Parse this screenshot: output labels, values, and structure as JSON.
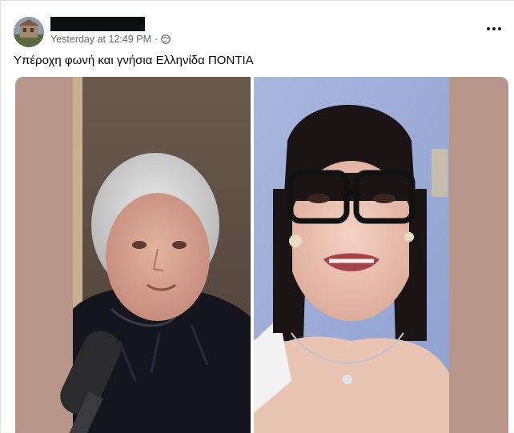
{
  "post": {
    "timestamp": "Yesterday at 12:49 PM",
    "separator": "·",
    "caption": "Υπέροχη φωνή και γνήσια Ελληνίδα ΠΟΝΤΙΑ"
  },
  "icons": {
    "privacy": "globe-icon",
    "menu": "more-horizontal-icon"
  },
  "colors": {
    "text_primary": "#050505",
    "text_secondary": "#65676b",
    "media_background": "#b8978a"
  }
}
